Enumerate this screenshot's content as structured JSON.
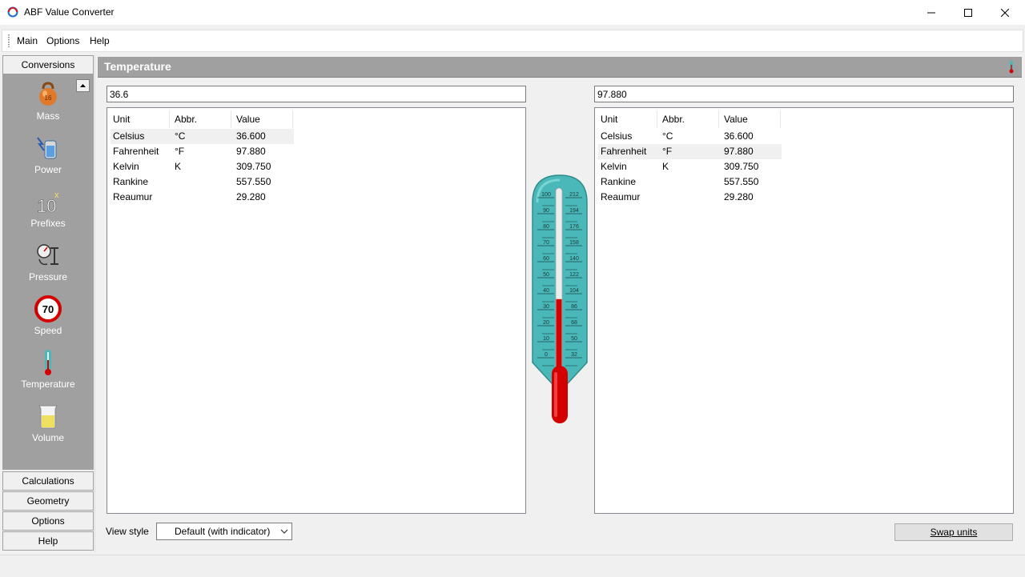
{
  "window": {
    "title": "ABF Value Converter",
    "controls": {
      "minimize": "—",
      "maximize": "☐",
      "close": "✕"
    }
  },
  "menu": [
    "Main",
    "Options",
    "Help"
  ],
  "sidebar": {
    "top_button": "Conversions",
    "items": [
      {
        "label": "Mass",
        "icon": "kettlebell-icon"
      },
      {
        "label": "Power",
        "icon": "battery-icon"
      },
      {
        "label": "Prefixes",
        "icon": "power-of-ten-icon"
      },
      {
        "label": "Pressure",
        "icon": "pressure-gauge-icon"
      },
      {
        "label": "Speed",
        "icon": "speed-limit-sign-icon",
        "sign_text": "70"
      },
      {
        "label": "Temperature",
        "icon": "thermometer-icon"
      },
      {
        "label": "Volume",
        "icon": "beaker-icon"
      }
    ],
    "bottom_buttons": [
      "Calculations",
      "Geometry",
      "Options",
      "Help"
    ]
  },
  "panel": {
    "title": "Temperature"
  },
  "columns": {
    "unit": "Unit",
    "abbr": "Abbr.",
    "value": "Value"
  },
  "left": {
    "input": "36.6",
    "selected_row": 0,
    "rows": [
      {
        "unit": "Celsius",
        "abbr": "°C",
        "value": "36.600"
      },
      {
        "unit": "Fahrenheit",
        "abbr": "°F",
        "value": "97.880"
      },
      {
        "unit": "Kelvin",
        "abbr": "K",
        "value": "309.750"
      },
      {
        "unit": "Rankine",
        "abbr": "",
        "value": "557.550"
      },
      {
        "unit": "Reaumur",
        "abbr": "",
        "value": "29.280"
      }
    ]
  },
  "right": {
    "input": "97.880",
    "selected_row": 1,
    "rows": [
      {
        "unit": "Celsius",
        "abbr": "°C",
        "value": "36.600"
      },
      {
        "unit": "Fahrenheit",
        "abbr": "°F",
        "value": "97.880"
      },
      {
        "unit": "Kelvin",
        "abbr": "K",
        "value": "309.750"
      },
      {
        "unit": "Rankine",
        "abbr": "",
        "value": "557.550"
      },
      {
        "unit": "Reaumur",
        "abbr": "",
        "value": "29.280"
      }
    ]
  },
  "thermometer": {
    "celsius_ticks": [
      "100",
      "90",
      "80",
      "70",
      "60",
      "50",
      "40",
      "30",
      "20",
      "10",
      "0"
    ],
    "fahrenheit_ticks": [
      "212",
      "194",
      "176",
      "158",
      "140",
      "122",
      "104",
      "86",
      "68",
      "50",
      "32"
    ],
    "level_celsius": 36.6,
    "colors": {
      "body": "#4ab8b8",
      "mercury": "#d40000"
    }
  },
  "view_style": {
    "label": "View style",
    "value": "Default (with indicator)"
  },
  "swap_button": "Swap units"
}
